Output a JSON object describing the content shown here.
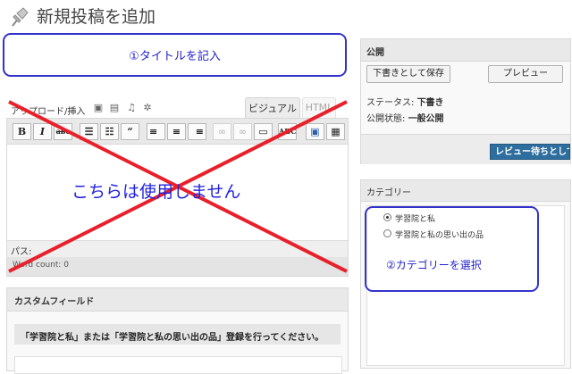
{
  "header": {
    "title": "新規投稿を追加",
    "icon": "pushpin-icon"
  },
  "title_field": {
    "annotation": "①タイトルを記入"
  },
  "editor": {
    "upload_label": "アップロード/挿入",
    "media_icons": [
      "image-icon",
      "video-icon",
      "music-icon",
      "media-gear-icon"
    ],
    "tabs": {
      "visual": "ビジュアル",
      "html": "HTML"
    },
    "toolbar": [
      {
        "name": "bold-button",
        "glyph": "B"
      },
      {
        "name": "italic-button",
        "glyph": "I"
      },
      {
        "name": "strikethrough-button",
        "glyph": "abc"
      },
      {
        "name": "bullet-list-button",
        "glyph": "☰"
      },
      {
        "name": "numbered-list-button",
        "glyph": "☷"
      },
      {
        "name": "blockquote-button",
        "glyph": "“"
      },
      {
        "name": "align-left-button",
        "glyph": "≡"
      },
      {
        "name": "align-center-button",
        "glyph": "≡"
      },
      {
        "name": "align-right-button",
        "glyph": "≡"
      },
      {
        "name": "insert-link-button",
        "glyph": "∞"
      },
      {
        "name": "unlink-button",
        "glyph": "∞"
      },
      {
        "name": "insert-more-button",
        "glyph": "▭"
      },
      {
        "name": "spellcheck-button",
        "glyph": "ABC"
      },
      {
        "name": "fullscreen-button",
        "glyph": "▣"
      },
      {
        "name": "kitchen-sink-button",
        "glyph": "▦"
      }
    ],
    "overlay_notice": "こちらは使用しません",
    "path_label": "パス:",
    "word_count": "Word count: 0"
  },
  "custom_fields": {
    "title": "カスタムフィールド",
    "notice": "「学習院と私」または「学習院と私の思い出の品」登録を行ってください。"
  },
  "publish": {
    "title": "公開",
    "save_draft": "下書きとして保存",
    "preview": "プレビュー",
    "status_label": "ステータス:",
    "status_value": "下書き",
    "visibility_label": "公開状態:",
    "visibility_value": "一般公開",
    "review_button": "レビュー待ちとして送信"
  },
  "category": {
    "title": "カテゴリー",
    "items": [
      {
        "label": "学習院と私",
        "selected": true
      },
      {
        "label": "学習院と私の思い出の品",
        "selected": false
      }
    ],
    "annotation": "②カテゴリーを選択"
  },
  "colors": {
    "annotation_blue": "#2222cc",
    "cross_red": "#e8202a",
    "primary_button": "#2e6e9e"
  }
}
